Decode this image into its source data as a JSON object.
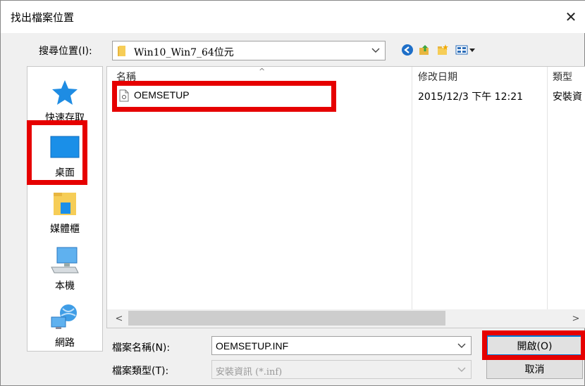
{
  "dialog": {
    "title": "找出檔案位置",
    "close_glyph": "✕"
  },
  "look_in": {
    "label": "搜尋位置(I):",
    "value": "Win10_Win7_64位元"
  },
  "places": [
    {
      "label": "快速存取",
      "icon": "star-icon"
    },
    {
      "label": "桌面",
      "icon": "desktop-icon"
    },
    {
      "label": "媒體櫃",
      "icon": "libraries-icon"
    },
    {
      "label": "本機",
      "icon": "computer-icon"
    },
    {
      "label": "網路",
      "icon": "network-icon"
    }
  ],
  "file_list": {
    "columns": [
      "名稱",
      "修改日期",
      "類型"
    ],
    "sort_glyph": "^",
    "rows": [
      {
        "name": "OEMSETUP",
        "modified": "2015/12/3 下午 12:21",
        "type": "安裝資"
      }
    ],
    "scroll_left": "<",
    "scroll_right": ">"
  },
  "file_name": {
    "label": "檔案名稱(N):",
    "value": "OEMSETUP.INF"
  },
  "file_type": {
    "label": "檔案類型(T):",
    "value": "安裝資訊 (*.inf)"
  },
  "buttons": {
    "open": "開啟(O)",
    "cancel": "取消"
  },
  "colors": {
    "highlight": "#e60000",
    "accent": "#0078d7"
  }
}
